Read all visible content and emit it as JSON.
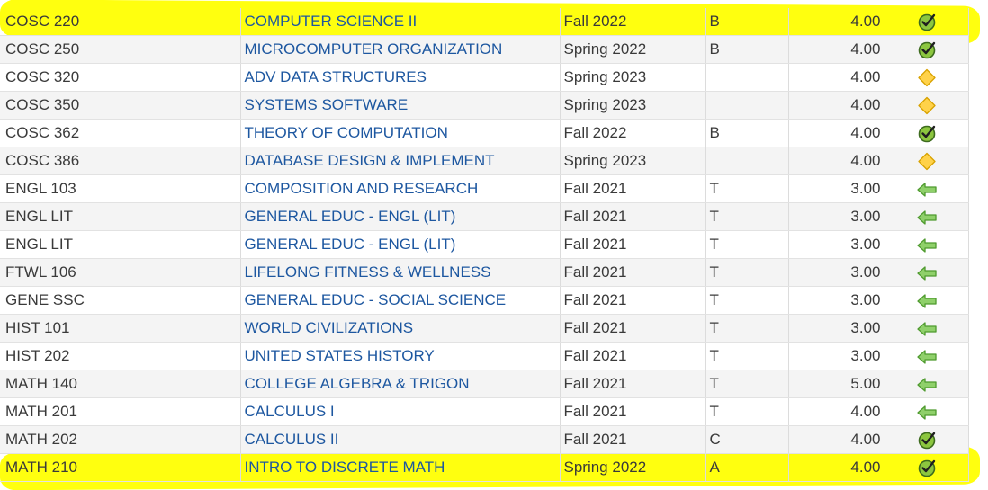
{
  "rows": [
    {
      "code": "COSC 220",
      "title": "COMPUTER SCIENCE II",
      "term": "Fall 2022",
      "grade": "B",
      "credits": "4.00",
      "status": "check-icon",
      "highlight": true
    },
    {
      "code": "COSC 250",
      "title": "MICROCOMPUTER ORGANIZATION",
      "term": "Spring 2022",
      "grade": "B",
      "credits": "4.00",
      "status": "check-icon",
      "highlight": false
    },
    {
      "code": "COSC 320",
      "title": "ADV DATA STRUCTURES",
      "term": "Spring 2023",
      "grade": "",
      "credits": "4.00",
      "status": "diamond-icon",
      "highlight": false
    },
    {
      "code": "COSC 350",
      "title": "SYSTEMS SOFTWARE",
      "term": "Spring 2023",
      "grade": "",
      "credits": "4.00",
      "status": "diamond-icon",
      "highlight": false
    },
    {
      "code": "COSC 362",
      "title": "THEORY OF COMPUTATION",
      "term": "Fall 2022",
      "grade": "B",
      "credits": "4.00",
      "status": "check-icon",
      "highlight": false
    },
    {
      "code": "COSC 386",
      "title": "DATABASE DESIGN & IMPLEMENT",
      "term": "Spring 2023",
      "grade": "",
      "credits": "4.00",
      "status": "diamond-icon",
      "highlight": false
    },
    {
      "code": "ENGL 103",
      "title": "COMPOSITION AND RESEARCH",
      "term": "Fall 2021",
      "grade": "T",
      "credits": "3.00",
      "status": "arrow-left-icon",
      "highlight": false
    },
    {
      "code": "ENGL LIT",
      "title": "GENERAL EDUC - ENGL (LIT)",
      "term": "Fall 2021",
      "grade": "T",
      "credits": "3.00",
      "status": "arrow-left-icon",
      "highlight": false
    },
    {
      "code": "ENGL LIT",
      "title": "GENERAL EDUC - ENGL (LIT)",
      "term": "Fall 2021",
      "grade": "T",
      "credits": "3.00",
      "status": "arrow-left-icon",
      "highlight": false
    },
    {
      "code": "FTWL 106",
      "title": "LIFELONG FITNESS & WELLNESS",
      "term": "Fall 2021",
      "grade": "T",
      "credits": "3.00",
      "status": "arrow-left-icon",
      "highlight": false
    },
    {
      "code": "GENE SSC",
      "title": "GENERAL EDUC - SOCIAL SCIENCE",
      "term": "Fall 2021",
      "grade": "T",
      "credits": "3.00",
      "status": "arrow-left-icon",
      "highlight": false
    },
    {
      "code": "HIST 101",
      "title": "WORLD CIVILIZATIONS",
      "term": "Fall 2021",
      "grade": "T",
      "credits": "3.00",
      "status": "arrow-left-icon",
      "highlight": false
    },
    {
      "code": "HIST 202",
      "title": "UNITED STATES HISTORY",
      "term": "Fall 2021",
      "grade": "T",
      "credits": "3.00",
      "status": "arrow-left-icon",
      "highlight": false
    },
    {
      "code": "MATH 140",
      "title": "COLLEGE ALGEBRA & TRIGON",
      "term": "Fall 2021",
      "grade": "T",
      "credits": "5.00",
      "status": "arrow-left-icon",
      "highlight": false
    },
    {
      "code": "MATH 201",
      "title": "CALCULUS I",
      "term": "Fall 2021",
      "grade": "T",
      "credits": "4.00",
      "status": "arrow-left-icon",
      "highlight": false
    },
    {
      "code": "MATH 202",
      "title": "CALCULUS II",
      "term": "Fall 2021",
      "grade": "C",
      "credits": "4.00",
      "status": "check-icon",
      "highlight": false
    },
    {
      "code": "MATH 210",
      "title": "INTRO TO DISCRETE MATH",
      "term": "Spring 2022",
      "grade": "A",
      "credits": "4.00",
      "status": "check-icon",
      "highlight": true
    }
  ],
  "colors": {
    "highlight": "#ffff0f",
    "title_link": "#1d57a0",
    "text": "#3a3a3a",
    "check_fill": "#8cc63f",
    "diamond_fill": "#ffd24a",
    "arrow_fill": "#8fd06a"
  }
}
